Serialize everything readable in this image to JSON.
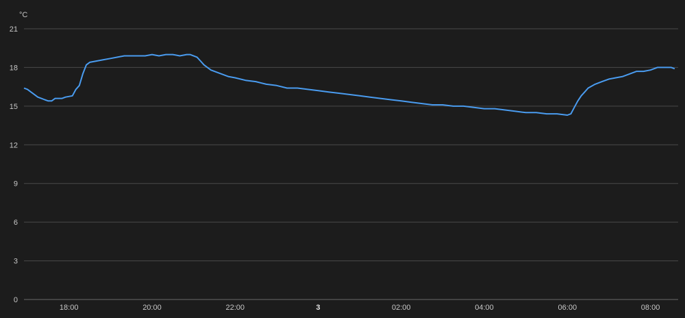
{
  "chart_data": {
    "type": "line",
    "title": "",
    "xlabel": "",
    "ylabel": "",
    "y_unit": "°C",
    "ylim": [
      0,
      21
    ],
    "y_ticks": [
      0,
      3,
      6,
      9,
      12,
      15,
      18,
      21
    ],
    "xlim": [
      "16:55",
      "08:40"
    ],
    "x_ticks": [
      {
        "time": "18:00",
        "label": "18:00",
        "bold": false
      },
      {
        "time": "20:00",
        "label": "20:00",
        "bold": false
      },
      {
        "time": "22:00",
        "label": "22:00",
        "bold": false
      },
      {
        "time": "00:00",
        "label": "3",
        "bold": true
      },
      {
        "time": "02:00",
        "label": "02:00",
        "bold": false
      },
      {
        "time": "04:00",
        "label": "04:00",
        "bold": false
      },
      {
        "time": "06:00",
        "label": "06:00",
        "bold": false
      },
      {
        "time": "08:00",
        "label": "08:00",
        "bold": false
      }
    ],
    "grid": true,
    "legend": "none",
    "colors": {
      "background": "#1c1c1c",
      "grid": "#4a4a4a",
      "axis": "#6a6a6a",
      "text": "#c8c8c8",
      "series": "#4a9cf0"
    },
    "series": [
      {
        "points": [
          [
            "16:55",
            16.4
          ],
          [
            "17:00",
            16.3
          ],
          [
            "17:05",
            16.1
          ],
          [
            "17:10",
            15.9
          ],
          [
            "17:15",
            15.7
          ],
          [
            "17:20",
            15.6
          ],
          [
            "17:25",
            15.5
          ],
          [
            "17:30",
            15.4
          ],
          [
            "17:35",
            15.4
          ],
          [
            "17:40",
            15.6
          ],
          [
            "17:50",
            15.6
          ],
          [
            "17:55",
            15.7
          ],
          [
            "18:05",
            15.8
          ],
          [
            "18:10",
            16.3
          ],
          [
            "18:15",
            16.6
          ],
          [
            "18:20",
            17.5
          ],
          [
            "18:25",
            18.2
          ],
          [
            "18:30",
            18.4
          ],
          [
            "18:40",
            18.5
          ],
          [
            "18:50",
            18.6
          ],
          [
            "19:00",
            18.7
          ],
          [
            "19:10",
            18.8
          ],
          [
            "19:20",
            18.9
          ],
          [
            "19:30",
            18.9
          ],
          [
            "19:50",
            18.9
          ],
          [
            "20:00",
            19.0
          ],
          [
            "20:10",
            18.9
          ],
          [
            "20:20",
            19.0
          ],
          [
            "20:30",
            19.0
          ],
          [
            "20:40",
            18.9
          ],
          [
            "20:50",
            19.0
          ],
          [
            "20:55",
            19.0
          ],
          [
            "21:05",
            18.8
          ],
          [
            "21:10",
            18.5
          ],
          [
            "21:15",
            18.2
          ],
          [
            "21:20",
            18.0
          ],
          [
            "21:25",
            17.8
          ],
          [
            "21:30",
            17.7
          ],
          [
            "21:40",
            17.5
          ],
          [
            "21:50",
            17.3
          ],
          [
            "22:00",
            17.2
          ],
          [
            "22:15",
            17.0
          ],
          [
            "22:30",
            16.9
          ],
          [
            "22:45",
            16.7
          ],
          [
            "23:00",
            16.6
          ],
          [
            "23:15",
            16.4
          ],
          [
            "23:30",
            16.4
          ],
          [
            "23:45",
            16.3
          ],
          [
            "00:00",
            16.2
          ],
          [
            "00:15",
            16.1
          ],
          [
            "00:30",
            16.0
          ],
          [
            "00:45",
            15.9
          ],
          [
            "01:00",
            15.8
          ],
          [
            "01:15",
            15.7
          ],
          [
            "01:30",
            15.6
          ],
          [
            "01:45",
            15.5
          ],
          [
            "02:00",
            15.4
          ],
          [
            "02:15",
            15.3
          ],
          [
            "02:30",
            15.2
          ],
          [
            "02:45",
            15.1
          ],
          [
            "03:00",
            15.1
          ],
          [
            "03:15",
            15.0
          ],
          [
            "03:30",
            15.0
          ],
          [
            "03:45",
            14.9
          ],
          [
            "04:00",
            14.8
          ],
          [
            "04:15",
            14.8
          ],
          [
            "04:30",
            14.7
          ],
          [
            "04:45",
            14.6
          ],
          [
            "05:00",
            14.5
          ],
          [
            "05:15",
            14.5
          ],
          [
            "05:30",
            14.4
          ],
          [
            "05:45",
            14.4
          ],
          [
            "06:00",
            14.3
          ],
          [
            "06:05",
            14.4
          ],
          [
            "06:10",
            14.9
          ],
          [
            "06:15",
            15.4
          ],
          [
            "06:20",
            15.8
          ],
          [
            "06:25",
            16.1
          ],
          [
            "06:30",
            16.4
          ],
          [
            "06:40",
            16.7
          ],
          [
            "06:50",
            16.9
          ],
          [
            "07:00",
            17.1
          ],
          [
            "07:10",
            17.2
          ],
          [
            "07:20",
            17.3
          ],
          [
            "07:30",
            17.5
          ],
          [
            "07:40",
            17.7
          ],
          [
            "07:50",
            17.7
          ],
          [
            "08:00",
            17.8
          ],
          [
            "08:10",
            18.0
          ],
          [
            "08:20",
            18.0
          ],
          [
            "08:30",
            18.0
          ],
          [
            "08:35",
            17.9
          ]
        ]
      }
    ]
  }
}
